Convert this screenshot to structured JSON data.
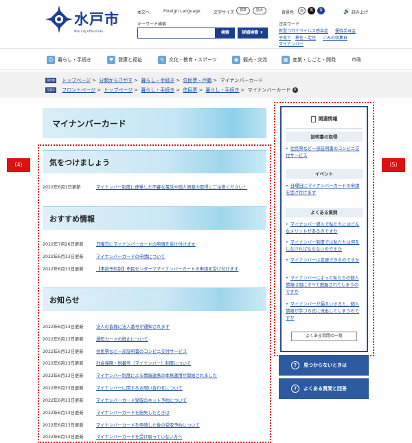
{
  "header": {
    "logo_text": "水戸市",
    "logo_sub": "Mito City Official Site",
    "util": {
      "home": "本文へ",
      "foreign": "Foreign Language",
      "text_size": "文字サイズ",
      "standard": "標準",
      "enlarge": "拡大",
      "bg_color": "背景色",
      "white": "白",
      "black": "黒",
      "blue": "青",
      "read_aloud": "読み上げ"
    },
    "search": {
      "label": "キーワード検索",
      "value": "",
      "button": "検索",
      "advanced": "詳細検索 ▼"
    },
    "hot_words": {
      "title": "注目ワード",
      "items": [
        "新型コロナウイルス感染症",
        "優待手当金",
        "子育て",
        "移住・定住",
        "ごみの収集日",
        "マイナンバー"
      ]
    }
  },
  "nav": [
    {
      "label": "暮らし・手続き",
      "icon": "people-icon"
    },
    {
      "label": "健康と福祉",
      "icon": "heart-icon"
    },
    {
      "label": "文化・教育・スポーツ",
      "icon": "brush-icon"
    },
    {
      "label": "観光・交流",
      "icon": "camera-icon"
    },
    {
      "label": "産業・しごと・開発",
      "icon": "building-icon"
    },
    {
      "label": "市政",
      "icon": ""
    }
  ],
  "breadcrumbs": {
    "row1_tag": "現在地",
    "row1": [
      "トップページ",
      "分類からさがす",
      "暮らし・手続き",
      "住民票・戸籍",
      "マイナンバーカード"
    ],
    "row2_tag": "元表示",
    "row2": [
      "フロントページ",
      "トップページ",
      "暮らし・手続き",
      "住民票",
      "暮らし・手続き",
      "マイナンバーカード"
    ]
  },
  "page_title": "マイナンバーカード",
  "badges": {
    "left": "（4）",
    "right": "（5）"
  },
  "sections": {
    "caution": {
      "title": "気をつけましょう",
      "items": [
        {
          "date": "2022年6月1日更新",
          "title": "マイナンバー制度に便乗した不審な電話や個人情報の取得にご注意ください！"
        }
      ]
    },
    "recommend": {
      "title": "おすすめ情報",
      "items": [
        {
          "date": "2022年7月26日更新",
          "title": "日曜日にマイナンバーカードの申請を受け付けます"
        },
        {
          "date": "2022年6月13日更新",
          "title": "マイナンバーカードの申請について"
        },
        {
          "date": "2022年6月13日更新",
          "title": "【事前予約制】市民センターでマイナンバーカードの申請を受け付けます"
        }
      ]
    },
    "news": {
      "title": "お知らせ",
      "items": [
        {
          "date": "2022年6月13日更新",
          "title": "法人の皆様に法人番号が通知されます"
        },
        {
          "date": "2022年6月13日更新",
          "title": "通知カードの廃止について"
        },
        {
          "date": "2022年6月13日更新",
          "title": "住民票など一部証明書のコンビニ交付サービス"
        },
        {
          "date": "2022年6月13日更新",
          "title": "社会保障・税番号（マイナンバー）制度について"
        },
        {
          "date": "2022年6月13日更新",
          "title": "マイナンバー制度による情報連携の本格運用が開始されました"
        },
        {
          "date": "2022年6月13日更新",
          "title": "マイナンバーに関するお問い合わせについて"
        },
        {
          "date": "2022年6月13日更新",
          "title": "マイナンバーカード受取のネット予約について"
        },
        {
          "date": "2022年6月13日更新",
          "title": "マイナンバーカードを紛失したときは"
        },
        {
          "date": "2022年6月13日更新",
          "title": "マイナンバーカードを申請した後の受取予約について"
        },
        {
          "date": "2022年6月13日更新",
          "title": "マイナンバーカードを受け取っていない方へ"
        }
      ]
    }
  },
  "sidebar": {
    "title": "関連情報",
    "cat1": "証明書の取得",
    "cat1_links": [
      "住民票など一部証明書のコンビニ交付サービス"
    ],
    "cat2": "イベント",
    "cat2_links": [
      "日曜日にマイナンバーカードの申請を受け付けます"
    ],
    "cat3": "よくある質問",
    "cat3_links": [
      "マイナンバー導入で私たちにはどんなメリットがあるのですか",
      "マイナンバー制度では私たちは何をしなければならないのですか",
      "マイナンバーは変更できるのですか",
      "マイナンバーによって私たちの個人情報は国にすべて把握されてしまうのですか",
      "マイナンバーが漏えいすると、個人情報が芋づる式に流出してしまうのですか"
    ],
    "faq_list_button": "よくある質問の一覧",
    "not_found": "見つからないときは",
    "faq_btn": "よくある質問と回答"
  }
}
